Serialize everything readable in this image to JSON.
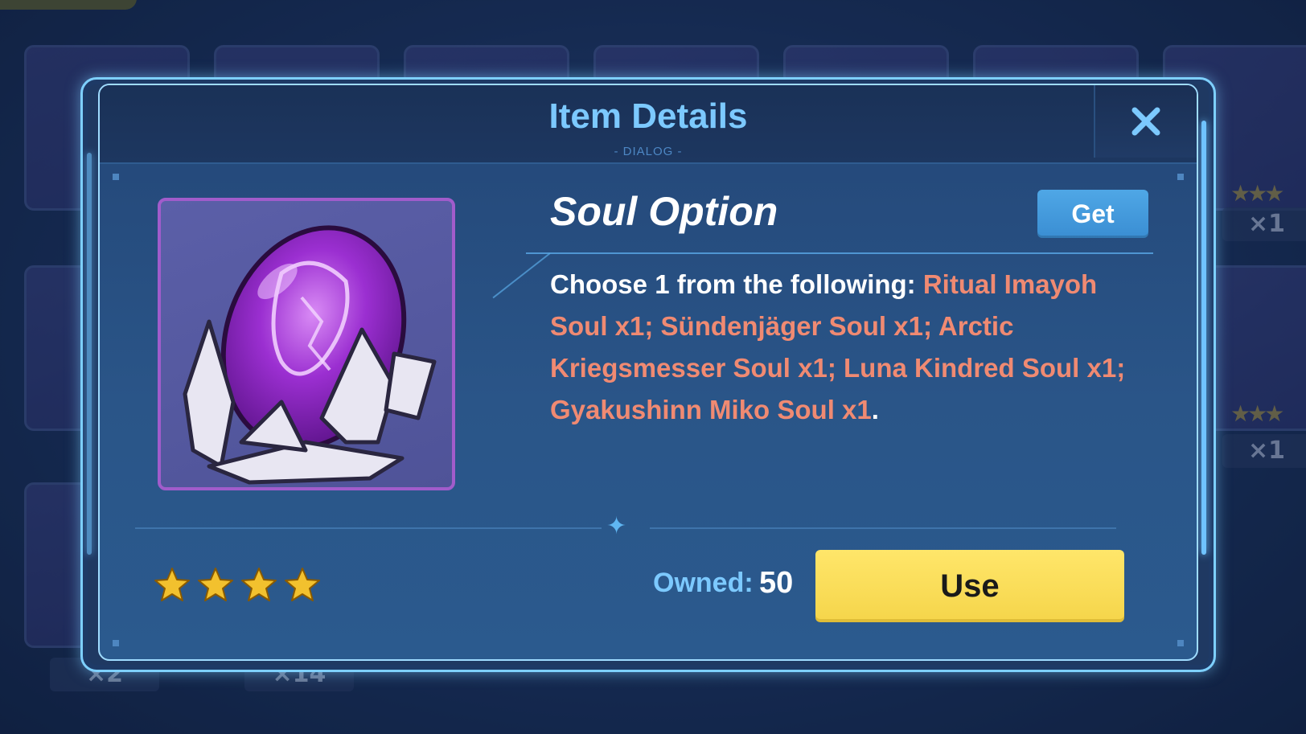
{
  "dialog": {
    "title": "Item Details",
    "subtitle": "- DIALOG -",
    "close_icon": "close-icon"
  },
  "item": {
    "name": "Soul Option",
    "icon": "purple-soul-crystal-icon",
    "rarity_stars": 4,
    "get_label": "Get",
    "description": {
      "intro": "Choose ",
      "count": "1",
      "after_count": " from the following: ",
      "options": [
        "Ritual Imayoh Soul x1",
        "Sündenjäger Soul x1",
        "Arctic Kriegsmesser Soul x1",
        "Luna Kindred Soul x1",
        "Gyakushinn Miko Soul x1"
      ],
      "separator": "; ",
      "end": "."
    }
  },
  "footer": {
    "owned_label": "Owned:",
    "owned_value": "50",
    "use_label": "Use"
  },
  "background": {
    "quantities": [
      "×1",
      "×1",
      "×2",
      "×14"
    ]
  },
  "colors": {
    "accent_blue": "#7cc9ff",
    "highlight": "#f08a72",
    "use_button": "#f5d54a",
    "get_button": "#3a8ed3",
    "item_frame": "#a15ccb",
    "star": "#f2c12e"
  }
}
